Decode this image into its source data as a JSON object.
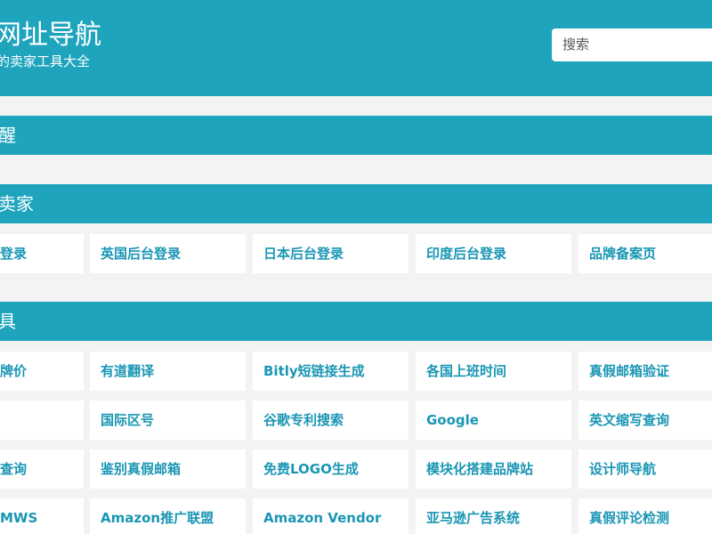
{
  "header": {
    "title": "网址导航",
    "subtitle": "的卖家工具大全",
    "search_placeholder": "搜索"
  },
  "sections": [
    {
      "title": "醒"
    },
    {
      "title": "卖家"
    },
    {
      "title": "具"
    }
  ],
  "seller_links": [
    "登录",
    "英国后台登录",
    "日本后台登录",
    "印度后台登录",
    "品牌备案页"
  ],
  "tool_rows": [
    [
      "牌价",
      "有道翻译",
      "Bitly短链接生成",
      "各国上班时间",
      "真假邮箱验证"
    ],
    [
      "",
      "国际区号",
      "谷歌专利搜索",
      "Google",
      "英文缩写查询"
    ],
    [
      "查询",
      "鉴别真假邮箱",
      "免费LOGO生成",
      "模块化搭建品牌站",
      "设计师导航"
    ],
    [
      "MWS",
      "Amazon推广联盟",
      "Amazon Vendor",
      "亚马逊广告系统",
      "真假评论检测"
    ]
  ],
  "colors": {
    "primary": "#1ea4bd",
    "link": "#1a96b4",
    "background": "#f3f3f3"
  }
}
